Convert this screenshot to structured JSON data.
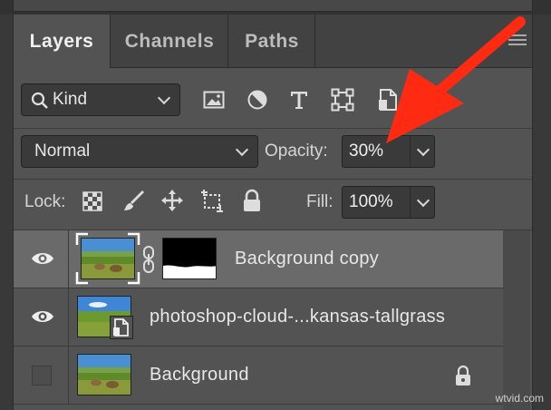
{
  "tabs": [
    {
      "label": "Layers",
      "active": true
    },
    {
      "label": "Channels",
      "active": false
    },
    {
      "label": "Paths",
      "active": false
    }
  ],
  "filter": {
    "kind_label": "Kind",
    "icons": [
      "image-filter-icon",
      "adjustment-filter-icon",
      "type-filter-icon",
      "shape-filter-icon",
      "smart-object-filter-icon"
    ]
  },
  "blend": {
    "mode": "Normal",
    "opacity_label": "Opacity:",
    "opacity_value": "30%"
  },
  "lock": {
    "label": "Lock:",
    "icons": [
      "lock-transparent-pixels-icon",
      "lock-image-pixels-icon",
      "lock-position-icon",
      "lock-artboard-icon",
      "lock-all-icon"
    ],
    "fill_label": "Fill:",
    "fill_value": "100%"
  },
  "layers": [
    {
      "name": "Background copy",
      "visible": true,
      "selected": true,
      "has_mask": true
    },
    {
      "name": "photoshop-cloud-...kansas-tallgrass",
      "visible": true,
      "selected": false,
      "smart_object": true
    },
    {
      "name": "Background",
      "visible": false,
      "selected": false,
      "locked": true
    }
  ],
  "annotation": {
    "arrow_color": "#ff2a12"
  },
  "watermark": "wtvid.com"
}
